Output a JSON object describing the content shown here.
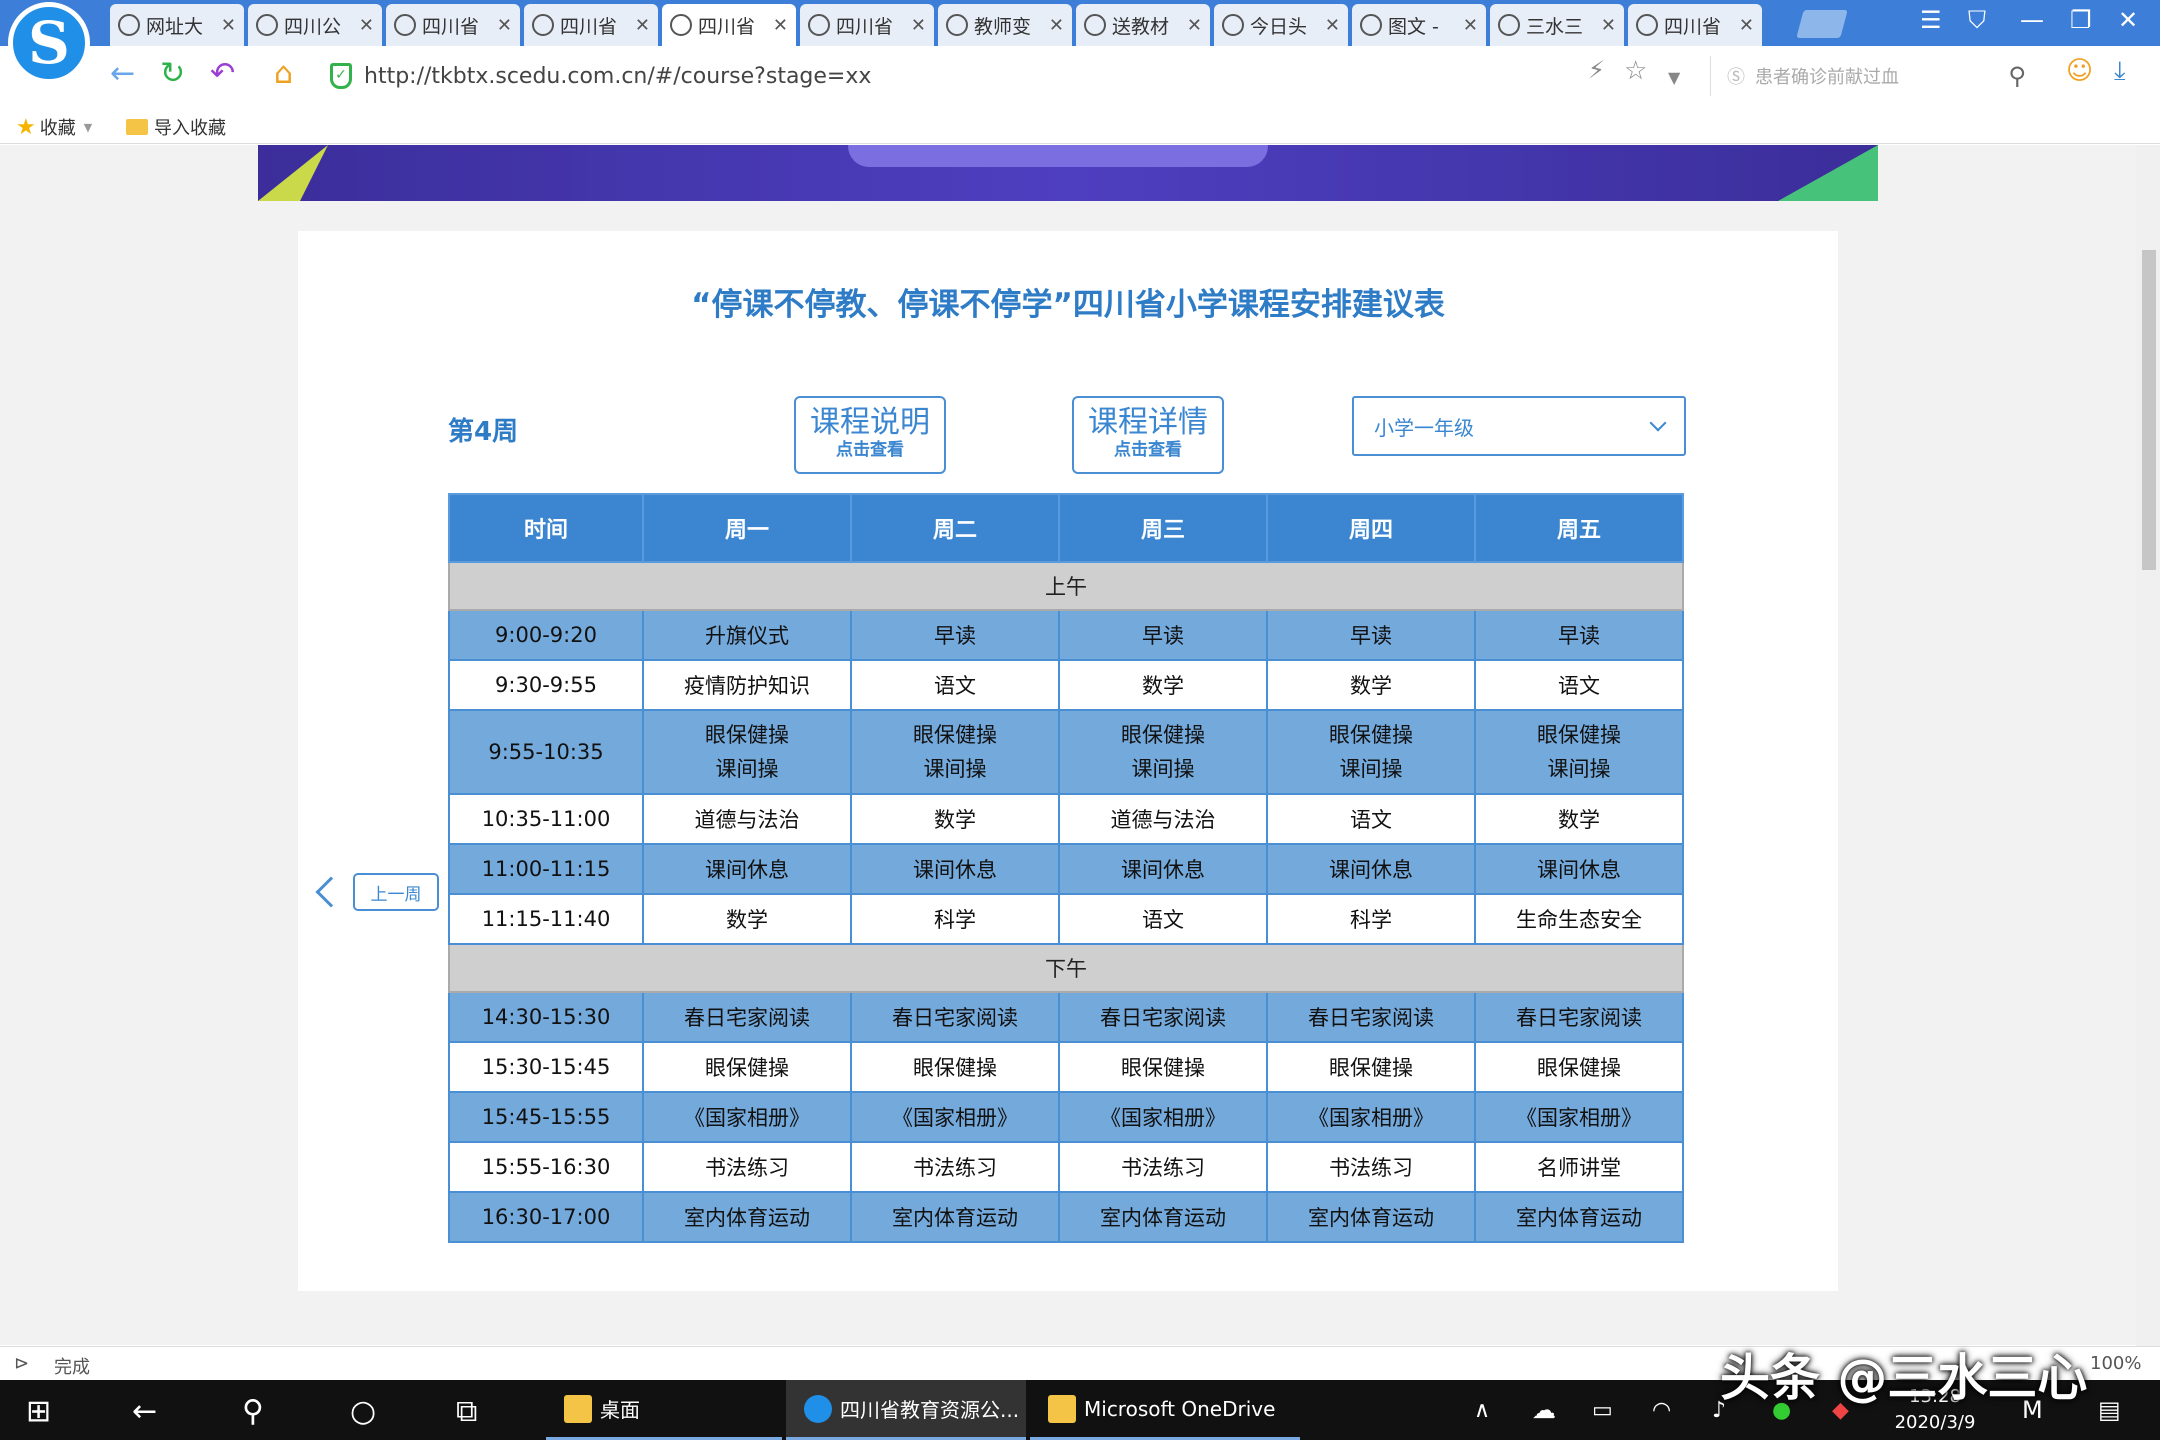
{
  "browser": {
    "tabs": [
      {
        "label": "网址大",
        "icon": "globe-icon"
      },
      {
        "label": "四川公",
        "icon": "sogou-icon"
      },
      {
        "label": "四川省",
        "icon": "kao-icon"
      },
      {
        "label": "四川省",
        "icon": "edu-icon"
      },
      {
        "label": "四川省",
        "icon": "edu-icon"
      },
      {
        "label": "四川省",
        "icon": "pen-icon"
      },
      {
        "label": "教师变",
        "icon": "teacher-icon"
      },
      {
        "label": "送教材",
        "icon": "sogou-icon"
      },
      {
        "label": "今日头",
        "icon": "news-icon"
      },
      {
        "label": "图文 -",
        "icon": "toutiao-icon"
      },
      {
        "label": "三水三",
        "icon": "user-icon"
      },
      {
        "label": "四川省",
        "icon": "user-icon"
      }
    ],
    "url": "http://tkbtx.scedu.com.cn/#/course?stage=xx",
    "search_placeholder": "患者确诊前献过血",
    "bookmarks": {
      "favorites": "收藏",
      "import": "导入收藏"
    },
    "status": "完成",
    "zoom": "100%"
  },
  "page": {
    "title": "“停课不停教、停课不停学”四川省小学课程安排建议表",
    "week": "第4周",
    "btn_intro": {
      "main": "课程说明",
      "sub": "点击查看"
    },
    "btn_detail": {
      "main": "课程详情",
      "sub": "点击查看"
    },
    "grade_select": "小学一年级",
    "prev_week": "上一周",
    "headers": [
      "时间",
      "周一",
      "周二",
      "周三",
      "周四",
      "周五"
    ],
    "morning_label": "上午",
    "afternoon_label": "下午",
    "morning": [
      {
        "time": "9:00-9:20",
        "cells": [
          "升旗仪式",
          "早读",
          "早读",
          "早读",
          "早读"
        ]
      },
      {
        "time": "9:30-9:55",
        "cells": [
          "疫情防护知识",
          "语文",
          "数学",
          "数学",
          "语文"
        ]
      },
      {
        "time": "9:55-10:35",
        "cells": [
          "眼保健操",
          "眼保健操",
          "眼保健操",
          "眼保健操",
          "眼保健操"
        ],
        "cells2": [
          "课间操",
          "课间操",
          "课间操",
          "课间操",
          "课间操"
        ]
      },
      {
        "time": "10:35-11:00",
        "cells": [
          "道德与法治",
          "数学",
          "道德与法治",
          "语文",
          "数学"
        ]
      },
      {
        "time": "11:00-11:15",
        "cells": [
          "课间休息",
          "课间休息",
          "课间休息",
          "课间休息",
          "课间休息"
        ]
      },
      {
        "time": "11:15-11:40",
        "cells": [
          "数学",
          "科学",
          "语文",
          "科学",
          "生命生态安全"
        ]
      }
    ],
    "afternoon": [
      {
        "time": "14:30-15:30",
        "cells": [
          "春日宅家阅读",
          "春日宅家阅读",
          "春日宅家阅读",
          "春日宅家阅读",
          "春日宅家阅读"
        ]
      },
      {
        "time": "15:30-15:45",
        "cells": [
          "眼保健操",
          "眼保健操",
          "眼保健操",
          "眼保健操",
          "眼保健操"
        ]
      },
      {
        "time": "15:45-15:55",
        "cells": [
          "《国家相册》",
          "《国家相册》",
          "《国家相册》",
          "《国家相册》",
          "《国家相册》"
        ]
      },
      {
        "time": "15:55-16:30",
        "cells": [
          "书法练习",
          "书法练习",
          "书法练习",
          "书法练习",
          "名师讲堂"
        ]
      },
      {
        "time": "16:30-17:00",
        "cells": [
          "室内体育运动",
          "室内体育运动",
          "室内体育运动",
          "室内体育运动",
          "室内体育运动"
        ]
      }
    ]
  },
  "taskbar": {
    "apps": [
      "桌面",
      "四川省教育资源公...",
      "Microsoft OneDrive"
    ],
    "time": "13:28",
    "date": "2020/3/9",
    "watermark": "头条 @三水三心"
  },
  "colors": {
    "accent": "#3c86d1",
    "row_blue": "#74a9dc",
    "section_gray": "#cfcfcf",
    "title": "#2e7bc6"
  }
}
